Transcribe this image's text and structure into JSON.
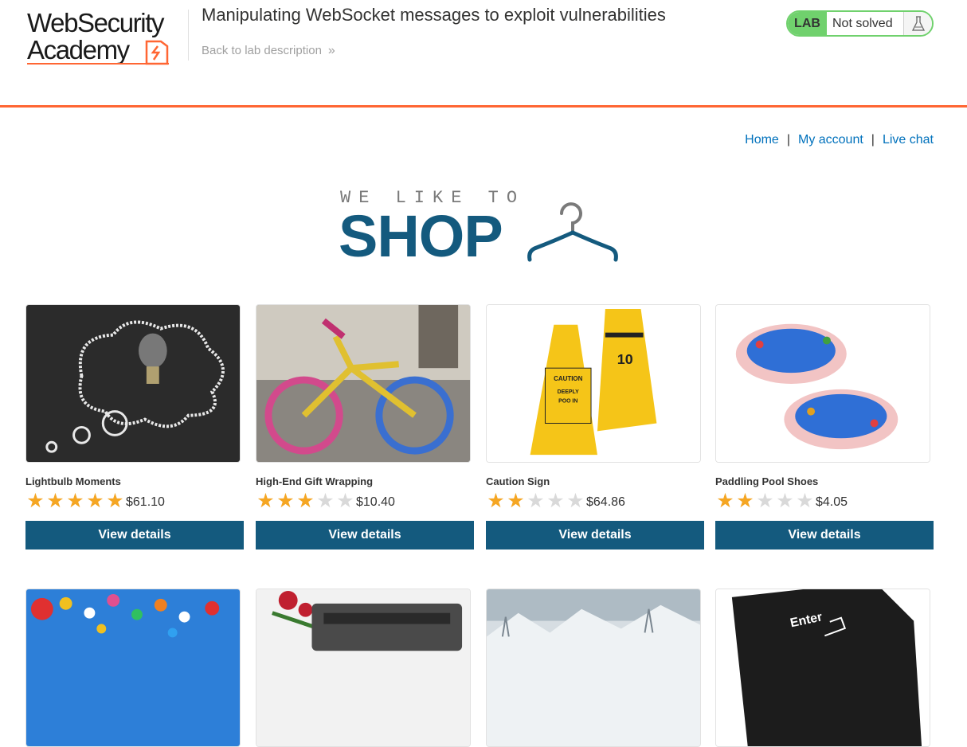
{
  "academy": {
    "logo_line1": "WebSecurity",
    "logo_line2": "Academy",
    "lab_title": "Manipulating WebSocket messages to exploit vulnerabilities",
    "back_link": "Back to lab description",
    "lab_badge": "LAB",
    "lab_status": "Not solved"
  },
  "colors": {
    "accent_orange": "#ff6633",
    "lab_green": "#70d16d",
    "shop_blue": "#145a7e",
    "link_blue": "#0071bc",
    "star_gold": "#f5a623"
  },
  "nav": {
    "home": "Home",
    "my_account": "My account",
    "live_chat": "Live chat",
    "separator": "|"
  },
  "banner": {
    "small": "WE LIKE TO",
    "big": "SHOP"
  },
  "products": [
    {
      "name": "Lightbulb Moments",
      "price": "$61.10",
      "rating": 5,
      "button": "View details",
      "image": "lightbulb-chalkboard"
    },
    {
      "name": "High-End Gift Wrapping",
      "price": "$10.40",
      "rating": 3,
      "button": "View details",
      "image": "knitted-bicycle"
    },
    {
      "name": "Caution Sign",
      "price": "$64.86",
      "rating": 2,
      "button": "View details",
      "image": "caution-signs"
    },
    {
      "name": "Paddling Pool Shoes",
      "price": "$4.05",
      "rating": 2,
      "button": "View details",
      "image": "paddling-pools"
    },
    {
      "image": "balloons"
    },
    {
      "image": "typewriter-roses"
    },
    {
      "image": "snowy-landscape"
    },
    {
      "image": "enter-key"
    }
  ]
}
